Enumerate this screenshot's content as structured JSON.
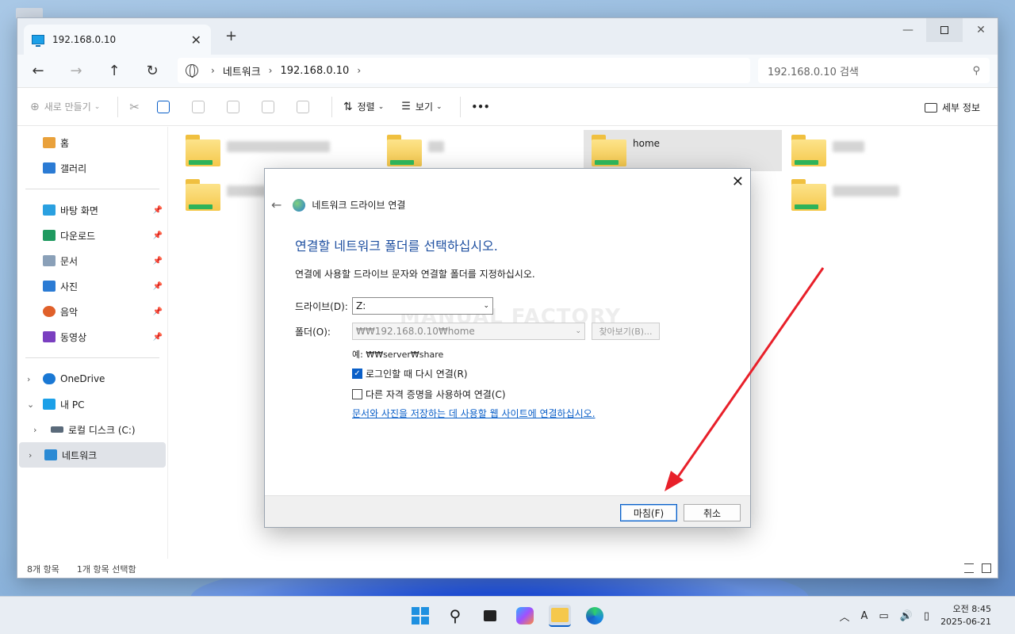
{
  "window": {
    "tab_title": "192.168.0.10",
    "new_tab": "+",
    "close_tab": "✕",
    "minimize": "—",
    "close": "✕"
  },
  "nav": {
    "back": "←",
    "forward": "→",
    "up": "↑",
    "refresh": "↻",
    "breadcrumb": [
      "네트워크",
      "192.168.0.10"
    ],
    "search_placeholder": "192.168.0.10 검색"
  },
  "toolbar": {
    "new": "새로 만들기",
    "sort": "정렬",
    "view": "보기",
    "more": "•••",
    "details": "세부 정보"
  },
  "sidebar": {
    "home": "홈",
    "gallery": "갤러리",
    "desktop": "바탕 화면",
    "downloads": "다운로드",
    "documents": "문서",
    "pictures": "사진",
    "music": "음악",
    "videos": "동영상",
    "onedrive": "OneDrive",
    "this_pc": "내 PC",
    "local_disk": "로컬 디스크 (C:)",
    "network": "네트워크"
  },
  "content": {
    "selected_folder": "home"
  },
  "status": {
    "count": "8개 항목",
    "selected": "1개 항목 선택함"
  },
  "dialog": {
    "header": "네트워크 드라이브 연결",
    "heading": "연결할 네트워크 폴더를 선택하십시오.",
    "description": "연결에 사용할 드라이브 문자와 연결할 폴더를 지정하십시오.",
    "drive_label": "드라이브(D):",
    "drive_value": "Z:",
    "folder_label": "폴더(O):",
    "folder_value": "₩₩192.168.0.10₩home",
    "browse": "찾아보기(B)...",
    "example": "예: ₩₩server₩share",
    "reconnect": "로그인할 때 다시 연결(R)",
    "reconnect_checked": true,
    "other_credentials": "다른 자격 증명을 사용하여 연결(C)",
    "other_credentials_checked": false,
    "link": "문서와 사진을 저장하는 데 사용할 웹 사이트에 연결하십시오.",
    "watermark": "MANUAL FACTORY",
    "finish": "마침(F)",
    "cancel": "취소"
  },
  "taskbar": {
    "ime": "A",
    "time": "오전 8:45",
    "date": "2025-06-21"
  },
  "colors": {
    "accent": "#0a5fc8",
    "annotation_arrow": "#e8202a"
  }
}
